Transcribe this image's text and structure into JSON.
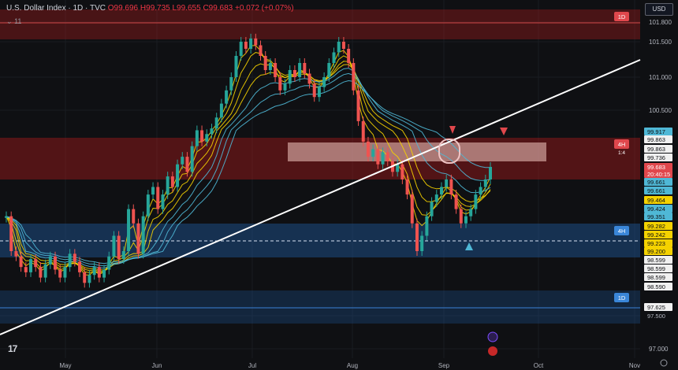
{
  "header": {
    "symbol": "U.S. Dollar Index · 1D · TVC",
    "o": "O99.696",
    "h": "H99.735",
    "l": "L99.655",
    "c": "C99.683",
    "chg": "+0.072 (+0.07%)",
    "indicator_count": "11"
  },
  "currency": "USD",
  "colors": {
    "bg": "#0f1013",
    "up": "#26a69a",
    "down": "#ef5350",
    "ema_fast": "#f5d200",
    "ema_slow": "#4fb8d6",
    "supply": "#b71c1c",
    "demand": "#1e5a9e",
    "trend": "#ffffff"
  },
  "chart_data": {
    "type": "candlestick",
    "title": "U.S. Dollar Index",
    "timeframe": "1D",
    "y_axis_ticks": [
      "101.800",
      "101.500",
      "101.000",
      "100.500",
      "97.500",
      "97.000"
    ],
    "x_axis_labels": [
      "May",
      "Jun",
      "Jul",
      "Aug",
      "Sep",
      "Oct",
      "Nov"
    ],
    "price_scale_labels": [
      {
        "text": "99.917",
        "kind": "cyan"
      },
      {
        "text": "99.863",
        "kind": "white"
      },
      {
        "text": "99.863",
        "kind": "white"
      },
      {
        "text": "99.736",
        "kind": "white"
      },
      {
        "text": "99.683",
        "kind": "red"
      },
      {
        "text": "20:40:15",
        "kind": "red"
      },
      {
        "text": "99.661",
        "kind": "cyan"
      },
      {
        "text": "99.661",
        "kind": "cyan"
      },
      {
        "text": "99.464",
        "kind": "yellow"
      },
      {
        "text": "99.424",
        "kind": "cyan"
      },
      {
        "text": "99.351",
        "kind": "cyan"
      },
      {
        "text": "99.282",
        "kind": "yellow"
      },
      {
        "text": "99.242",
        "kind": "yellow"
      },
      {
        "text": "99.223",
        "kind": "yellow"
      },
      {
        "text": "99.200",
        "kind": "yellow"
      },
      {
        "text": "98.599",
        "kind": "white"
      },
      {
        "text": "98.599",
        "kind": "white"
      },
      {
        "text": "98.599",
        "kind": "white"
      },
      {
        "text": "98.590",
        "kind": "white"
      },
      {
        "text": "97.625",
        "kind": "white"
      },
      {
        "text": "97.500",
        "kind": "plain"
      }
    ],
    "zones": [
      {
        "type": "supply",
        "timeframe_label": "1D"
      },
      {
        "type": "supply",
        "timeframe_label": "4H",
        "extra_label": "1:4"
      },
      {
        "type": "demand",
        "timeframe_label": "4H"
      },
      {
        "type": "demand",
        "timeframe_label": "1D"
      }
    ],
    "last_price": 99.683
  }
}
